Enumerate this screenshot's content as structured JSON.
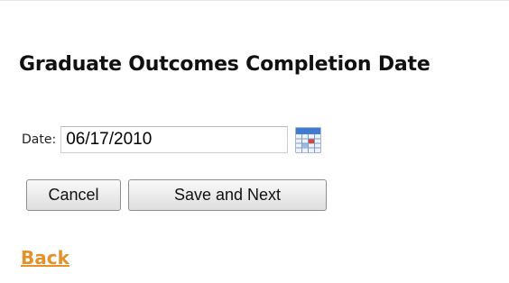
{
  "heading": "Graduate Outcomes Completion Date",
  "date_field": {
    "label": "Date:",
    "value": "06/17/2010"
  },
  "icons": {
    "calendar": "calendar-icon"
  },
  "buttons": {
    "cancel_label": "Cancel",
    "save_label": "Save and Next"
  },
  "back_link": "Back",
  "colors": {
    "link": "#e39128",
    "heading": "#111111"
  }
}
